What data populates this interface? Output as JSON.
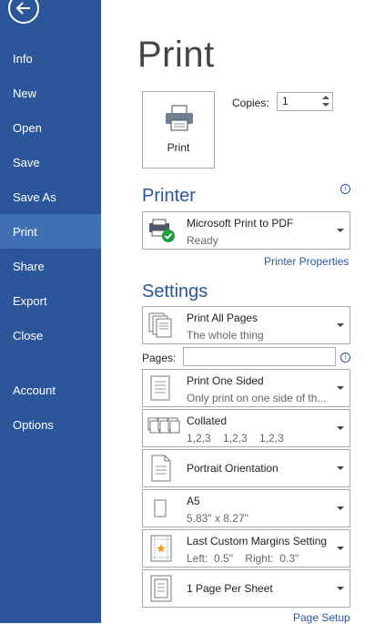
{
  "sidebar": {
    "items": [
      {
        "label": "Info"
      },
      {
        "label": "New"
      },
      {
        "label": "Open"
      },
      {
        "label": "Save"
      },
      {
        "label": "Save As"
      },
      {
        "label": "Print",
        "active": true
      },
      {
        "label": "Share"
      },
      {
        "label": "Export"
      },
      {
        "label": "Close"
      },
      {
        "label": "Account"
      },
      {
        "label": "Options"
      }
    ]
  },
  "main": {
    "title": "Print",
    "print_button_label": "Print",
    "copies_label": "Copies:",
    "copies_value": "1",
    "printer_heading": "Printer",
    "printer": {
      "name": "Microsoft Print to PDF",
      "status": "Ready"
    },
    "printer_properties_link": "Printer Properties",
    "settings_heading": "Settings",
    "print_range": {
      "title": "Print All Pages",
      "subtitle": "The whole thing"
    },
    "pages_label": "Pages:",
    "pages_value": "",
    "sides": {
      "title": "Print One Sided",
      "subtitle": "Only print on one side of th..."
    },
    "collation": {
      "title": "Collated",
      "subtitle": "1,2,3    1,2,3    1,2,3"
    },
    "orientation": {
      "title": "Portrait Orientation"
    },
    "paper_size": {
      "title": "A5",
      "subtitle": "5.83\" x 8.27\""
    },
    "margins": {
      "title": "Last Custom Margins Setting",
      "subtitle": "Left:  0.5\"    Right:  0.3\""
    },
    "pages_per_sheet": {
      "title": "1 Page Per Sheet"
    },
    "page_setup_link": "Page Setup"
  },
  "colors": {
    "sidebar": "#2b579a",
    "sidebar_active": "#3f6fb5",
    "accent": "#2b579a"
  }
}
